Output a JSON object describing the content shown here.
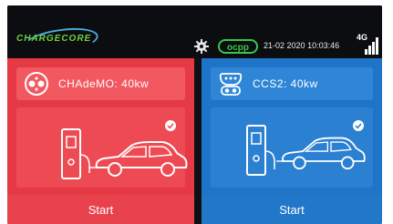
{
  "header": {
    "logo_text": "CHARGECORE",
    "ocpp_label": "ocpp",
    "date": "21-02 2020",
    "time": "10:03:46",
    "network": "4G"
  },
  "connectors": [
    {
      "name": "CHAdeMO",
      "power": "40kw",
      "label": "CHAdeMO: 40kw",
      "button": "Start",
      "color": "#e53a45"
    },
    {
      "name": "CCS2",
      "power": "40kw",
      "label": "CCS2: 40kw",
      "button": "Start",
      "color": "#1f74c8"
    }
  ],
  "colors": {
    "accent_green": "#35c84a",
    "red": "#e53a45",
    "blue": "#1f74c8"
  }
}
